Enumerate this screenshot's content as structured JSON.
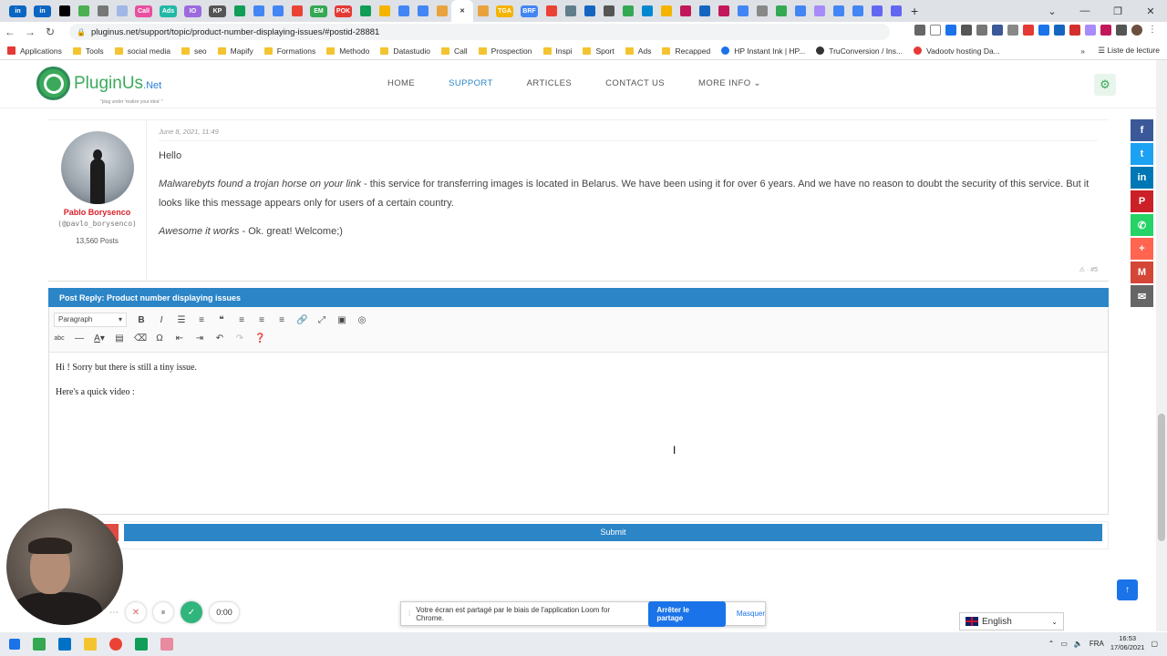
{
  "browser": {
    "tabs": [
      {
        "name": "linkedin",
        "color": "#0a66c2",
        "label": "in"
      },
      {
        "name": "linkedin",
        "color": "#0a66c2",
        "label": "in"
      },
      {
        "name": "notion",
        "color": "#000000",
        "label": ""
      },
      {
        "name": "tasks",
        "color": "#4caf50",
        "label": ""
      },
      {
        "name": "pin",
        "color": "#777777",
        "label": ""
      },
      {
        "name": "circle",
        "color": "#a0b7e8",
        "label": ""
      },
      {
        "name": "call",
        "color": "#e84fa0",
        "label": "Call"
      },
      {
        "name": "ads",
        "color": "#22b8a6",
        "label": "Ads"
      },
      {
        "name": "io",
        "color": "#9c6ade",
        "label": "IO"
      },
      {
        "name": "kp",
        "color": "#555555",
        "label": "KP"
      },
      {
        "name": "sheets",
        "color": "#0f9d58",
        "label": ""
      },
      {
        "name": "ads2",
        "color": "#4285f4",
        "label": ""
      },
      {
        "name": "ads3",
        "color": "#4285f4",
        "label": ""
      },
      {
        "name": "google",
        "color": "#ea4335",
        "label": ""
      },
      {
        "name": "em",
        "color": "#34a853",
        "label": "EM"
      },
      {
        "name": "pok",
        "color": "#e53935",
        "label": "POK"
      },
      {
        "name": "sheets2",
        "color": "#0f9d58",
        "label": ""
      },
      {
        "name": "drive",
        "color": "#f4b400",
        "label": ""
      },
      {
        "name": "chrome",
        "color": "#4285f4",
        "label": ""
      },
      {
        "name": "docs",
        "color": "#4285f4",
        "label": ""
      },
      {
        "name": "pinned",
        "color": "#e8a33d",
        "label": ""
      },
      {
        "name": "active-tab",
        "color": "#e53935",
        "label": "✕"
      },
      {
        "name": "pin2",
        "color": "#e8a33d",
        "label": ""
      },
      {
        "name": "tga",
        "color": "#f4b400",
        "label": "TGA"
      },
      {
        "name": "brf",
        "color": "#4285f4",
        "label": "BRF"
      },
      {
        "name": "gmail",
        "color": "#ea4335",
        "label": ""
      },
      {
        "name": "misc1",
        "color": "#607d8b",
        "label": ""
      },
      {
        "name": "misc2",
        "color": "#1565c0",
        "label": ""
      },
      {
        "name": "misc3",
        "color": "#555555",
        "label": ""
      },
      {
        "name": "misc4",
        "color": "#34a853",
        "label": ""
      },
      {
        "name": "misc5",
        "color": "#0288d1",
        "label": ""
      },
      {
        "name": "drive2",
        "color": "#f4b400",
        "label": ""
      },
      {
        "name": "misc6",
        "color": "#c2185b",
        "label": ""
      },
      {
        "name": "misc7",
        "color": "#1565c0",
        "label": ""
      },
      {
        "name": "misc8",
        "color": "#c2185b",
        "label": ""
      },
      {
        "name": "google2",
        "color": "#4285f4",
        "label": ""
      },
      {
        "name": "misc9",
        "color": "#888888",
        "label": ""
      },
      {
        "name": "misc10",
        "color": "#34a853",
        "label": ""
      },
      {
        "name": "google3",
        "color": "#4285f4",
        "label": ""
      },
      {
        "name": "misc11",
        "color": "#a78bfa",
        "label": ""
      },
      {
        "name": "google4",
        "color": "#4285f4",
        "label": ""
      },
      {
        "name": "google5",
        "color": "#4285f4",
        "label": ""
      },
      {
        "name": "misc12",
        "color": "#6366f1",
        "label": ""
      },
      {
        "name": "misc13",
        "color": "#6366f1",
        "label": ""
      }
    ],
    "new_tab": "+",
    "window_controls": [
      "⌄",
      "—",
      "❐",
      "✕"
    ],
    "url": "pluginus.net/support/topic/product-number-displaying-issues/#postid-28881",
    "bookmarks": [
      {
        "label": "Applications",
        "type": "apps"
      },
      {
        "label": "Tools",
        "type": "folder"
      },
      {
        "label": "social media",
        "type": "folder"
      },
      {
        "label": "seo",
        "type": "folder"
      },
      {
        "label": "Mapify",
        "type": "folder"
      },
      {
        "label": "Formations",
        "type": "folder"
      },
      {
        "label": "Methodo",
        "type": "folder"
      },
      {
        "label": "Datastudio",
        "type": "folder"
      },
      {
        "label": "Call",
        "type": "folder"
      },
      {
        "label": "Prospection",
        "type": "folder"
      },
      {
        "label": "Inspi",
        "type": "folder"
      },
      {
        "label": "Sport",
        "type": "folder"
      },
      {
        "label": "Ads",
        "type": "folder"
      },
      {
        "label": "Recapped",
        "type": "folder"
      },
      {
        "label": "HP Instant Ink | HP...",
        "type": "site"
      },
      {
        "label": "TruConversion / Ins...",
        "type": "site"
      },
      {
        "label": "Vadootv hosting Da...",
        "type": "site"
      }
    ],
    "more_bookmarks": "»",
    "reading_list": "Liste de lecture"
  },
  "site": {
    "logo_text": "PluginUs",
    "logo_suffix": ".Net",
    "logo_tagline": "\"plug under 'realize your idea' \"",
    "nav": [
      {
        "label": "HOME",
        "active": false
      },
      {
        "label": "SUPPORT",
        "active": true
      },
      {
        "label": "ARTICLES",
        "active": false
      },
      {
        "label": "CONTACT US",
        "active": false
      },
      {
        "label": "MORE INFO",
        "active": false,
        "dropdown": true
      }
    ]
  },
  "post": {
    "date": "June 8, 2021, 11:49",
    "author_name": "Pablo Borysenco",
    "author_handle": "(@pavlo_borysenco)",
    "author_posts": "13,560 Posts",
    "greeting": "Hello",
    "p1_em": "Malwarebyts found a trojan horse on your link",
    "p1_rest": " - this service for transferring images is located in Belarus.  We have been using it for over 6 years. And we have no reason to doubt the security of this service.  But it looks like this message appears only for users of a certain country.",
    "p2_em": "Awesome it works",
    "p2_rest": " - Ok.  great!  Welcome;)",
    "footer": "⚠ · #5"
  },
  "reply": {
    "header": "Post Reply: Product number displaying issues",
    "format_select": "Paragraph",
    "line1": "Hi ! Sorry but there is still a tiny issue.",
    "line2": "Here's a quick video :",
    "submit_label": "Submit"
  },
  "social_icons": [
    {
      "name": "facebook",
      "color": "#3b5998",
      "glyph": "f"
    },
    {
      "name": "twitter",
      "color": "#1da1f2",
      "glyph": "t"
    },
    {
      "name": "linkedin",
      "color": "#0077b5",
      "glyph": "in"
    },
    {
      "name": "pinterest",
      "color": "#cb2027",
      "glyph": "P"
    },
    {
      "name": "whatsapp",
      "color": "#25d366",
      "glyph": "✆"
    },
    {
      "name": "more",
      "color": "#ff6550",
      "glyph": "+"
    },
    {
      "name": "gmail",
      "color": "#d44638",
      "glyph": "M"
    },
    {
      "name": "email",
      "color": "#666666",
      "glyph": "✉"
    }
  ],
  "loom": {
    "timer": "0:00",
    "share_message": "Votre écran est partagé par le biais de l'application Loom for Chrome.",
    "stop_label": "Arrêter le partage",
    "hide_label": "Masquer"
  },
  "language": "English",
  "taskbar": {
    "lang": "FRA",
    "time": "16:53",
    "date": "17/06/2021"
  }
}
